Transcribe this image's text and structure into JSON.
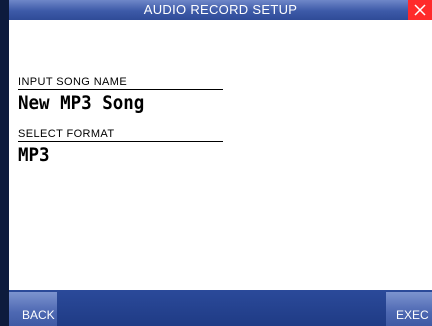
{
  "header": {
    "title": "AUDIO RECORD SETUP",
    "close_icon": "close-x-icon"
  },
  "fields": {
    "song_name": {
      "label": "INPUT SONG NAME",
      "value": "New MP3 Song"
    },
    "format": {
      "label": "SELECT FORMAT",
      "value": "MP3"
    }
  },
  "footer": {
    "back_label": "BACK",
    "exec_label": "EXEC"
  },
  "colors": {
    "accent": "#3d5aa8",
    "close": "#ff2a2a"
  }
}
